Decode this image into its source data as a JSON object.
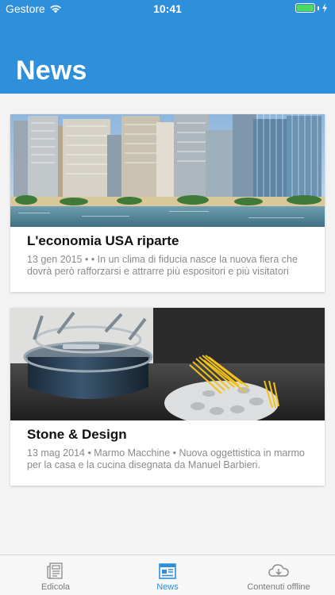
{
  "status_bar": {
    "carrier": "Gestore",
    "time": "10:41"
  },
  "header": {
    "title": "News"
  },
  "colors": {
    "accent": "#2e8fdb",
    "battery": "#4cd964"
  },
  "articles": [
    {
      "title": "L'economia USA riparte",
      "meta": "13 gen 2015 •  • In un clima di fiducia nasce la nuova fiera che dovrà però rafforzarsi e attrarre più espositori e più visitatori",
      "image": "city-skyline-photo"
    },
    {
      "title": "Stone & Design",
      "meta": "13 mag 2014 • Marmo Macchine • Nuova oggettistica in marmo per la casa e la cucina disegnata da Manuel Barbieri.",
      "image": "pasta-pot-photo"
    }
  ],
  "tabbar": {
    "items": [
      {
        "label": "Edicola",
        "icon": "newspaper-icon",
        "active": false
      },
      {
        "label": "News",
        "icon": "news-grid-icon",
        "active": true
      },
      {
        "label": "Contenuti offline",
        "icon": "cloud-download-icon",
        "active": false
      }
    ]
  }
}
